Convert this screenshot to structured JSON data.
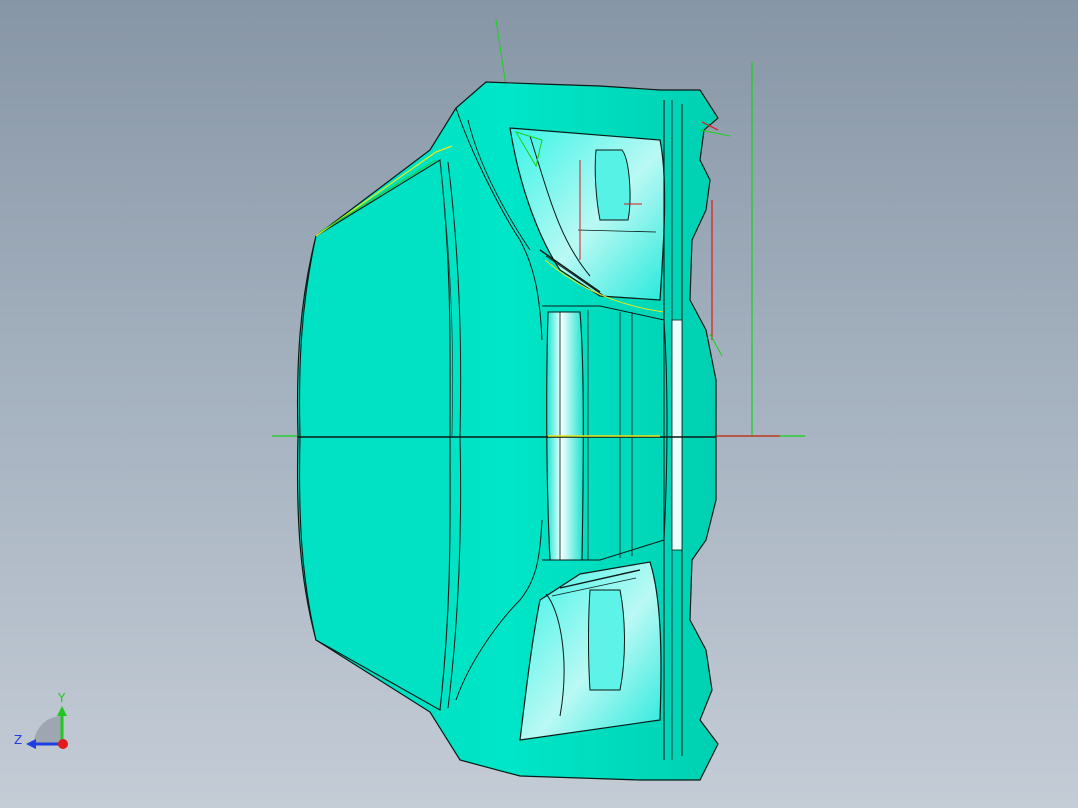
{
  "viewport": {
    "background_top": "#8796a6",
    "background_bottom": "#c4ccd6"
  },
  "model": {
    "body_color": "#00e3c4",
    "body_shadow": "#00c9ad",
    "edge_color": "#0a1a16",
    "highlight_color": "#ecfffb"
  },
  "reference": {
    "axis_color_green": "#19d21c",
    "axis_color_red": "#d81a1a",
    "sketch_color_yellow": "#e6e81e"
  },
  "triad": {
    "y_label": "Y",
    "z_label": "Z",
    "y_color": "#22c722",
    "z_color": "#1f3fe0",
    "x_color": "#e21b1b"
  }
}
